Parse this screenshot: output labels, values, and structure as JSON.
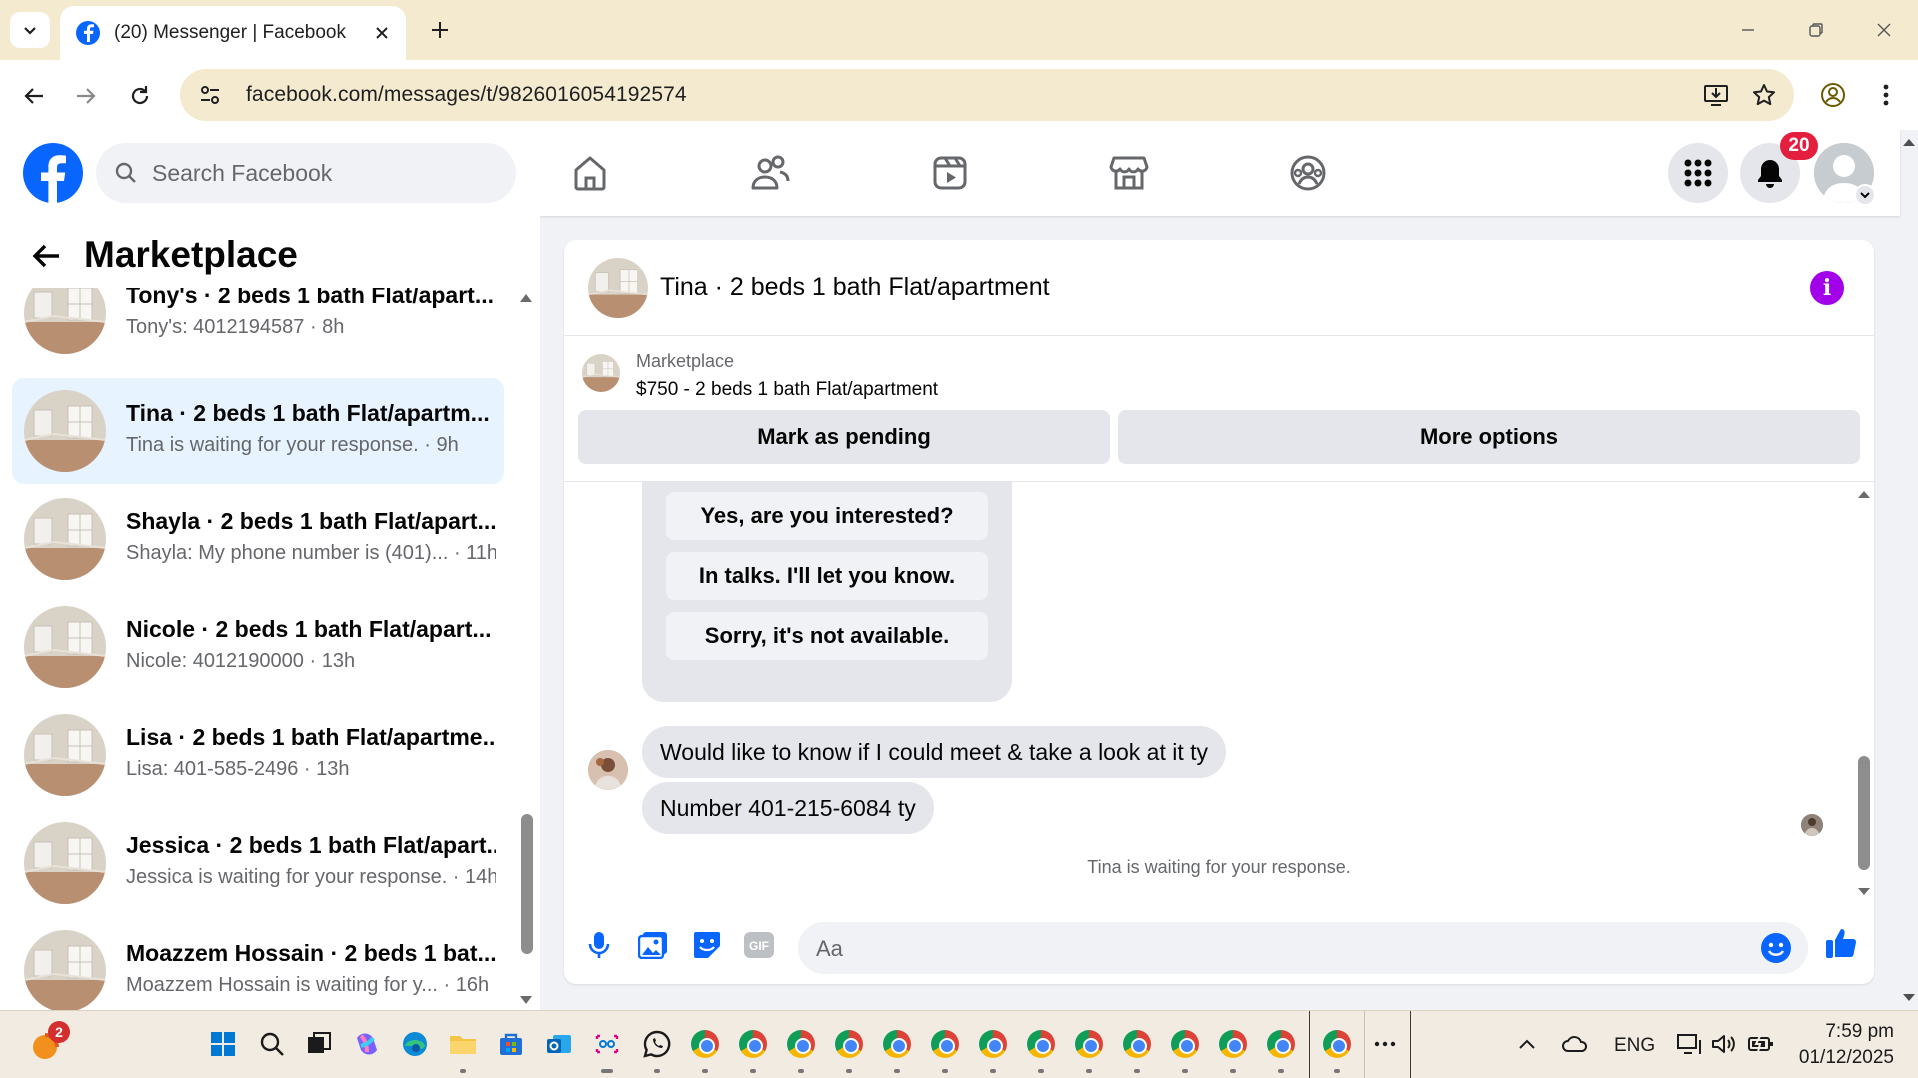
{
  "browser": {
    "tab_title": "(20) Messenger | Facebook",
    "url": "facebook.com/messages/t/9826016054192574"
  },
  "facebook": {
    "search_placeholder": "Search Facebook",
    "notification_count": "20"
  },
  "left_panel": {
    "title": "Marketplace",
    "conversations": [
      {
        "name": "Tony's · 2 beds 1 bath Flat/apart...",
        "snippet": "Tony's: 4012194587 · 8h"
      },
      {
        "name": "Tina · 2 beds 1 bath Flat/apartm...",
        "snippet": "Tina is waiting for your response. · 9h"
      },
      {
        "name": "Shayla · 2 beds 1 bath Flat/apart...",
        "snippet": "Shayla: My phone number is (401)... · 11h"
      },
      {
        "name": "Nicole · 2 beds 1 bath Flat/apart...",
        "snippet": "Nicole: 4012190000 · 13h"
      },
      {
        "name": "Lisa · 2 beds 1 bath Flat/apartme...",
        "snippet": "Lisa: 401-585-2496 · 13h"
      },
      {
        "name": "Jessica · 2 beds 1 bath Flat/apart...",
        "snippet": "Jessica is waiting for your response. · 14h"
      },
      {
        "name": "Moazzem Hossain · 2 beds 1 bat...",
        "snippet": "Moazzem Hossain is waiting for y... · 16h"
      }
    ]
  },
  "chat": {
    "title": "Tina · 2 beds 1 bath Flat/apartment",
    "marketplace_label": "Marketplace",
    "listing": "$750 - 2 beds 1 bath Flat/apartment",
    "mark_pending": "Mark as pending",
    "more_options": "More options",
    "quick_replies": [
      "Yes, are you interested?",
      "In talks. I'll let you know.",
      "Sorry, it's not available."
    ],
    "messages": [
      "Would like to know if I could meet & take a look at it ty",
      "Number 401-215-6084 ty"
    ],
    "waiting_status": "Tina is waiting for your response.",
    "composer_placeholder": "Aa",
    "gif_label": "GIF"
  },
  "taskbar": {
    "copilot_badge": "2",
    "language": "ENG",
    "time": "7:59 pm",
    "date": "01/12/2025"
  },
  "colors": {
    "facebook_blue": "#0866ff",
    "active_conversation": "#e7f3ff",
    "info_purple": "#a100e8",
    "badge_red": "#e41e3f",
    "browser_chrome": "#f3ead0"
  }
}
